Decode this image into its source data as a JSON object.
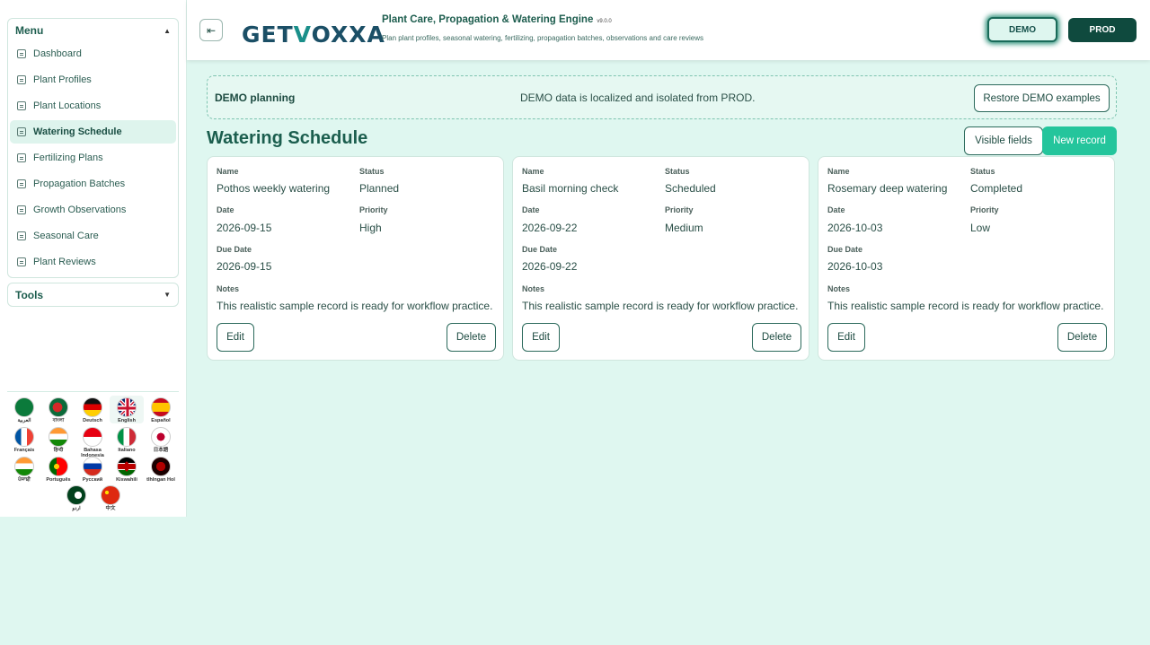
{
  "sidebar": {
    "menu_title": "Menu",
    "items": [
      {
        "label": "Dashboard"
      },
      {
        "label": "Plant Profiles"
      },
      {
        "label": "Plant Locations"
      },
      {
        "label": "Watering Schedule"
      },
      {
        "label": "Fertilizing Plans"
      },
      {
        "label": "Propagation Batches"
      },
      {
        "label": "Growth Observations"
      },
      {
        "label": "Seasonal Care"
      },
      {
        "label": "Plant Reviews"
      }
    ],
    "tools_title": "Tools",
    "languages": [
      {
        "label": "العربية"
      },
      {
        "label": "বাংলা"
      },
      {
        "label": "Deutsch"
      },
      {
        "label": "English"
      },
      {
        "label": "Español"
      },
      {
        "label": "Français"
      },
      {
        "label": "हिन्दी"
      },
      {
        "label": "Bahasa Indonesia"
      },
      {
        "label": "Italiano"
      },
      {
        "label": "日本語"
      },
      {
        "label": "ਪੰਜਾਬੀ"
      },
      {
        "label": "Português"
      },
      {
        "label": "Русский"
      },
      {
        "label": "Kiswahili"
      },
      {
        "label": "tlhIngan Hol"
      },
      {
        "label": "اردو"
      },
      {
        "label": "中文"
      }
    ]
  },
  "header": {
    "logo_a": "GET",
    "logo_b": "V",
    "logo_c": "OXXA",
    "title": "Plant Care, Propagation & Watering Engine",
    "version": "v9.0.0",
    "subtitle": "Plan plant profiles, seasonal watering, fertilizing, propagation batches, observations and care reviews",
    "demo_label": "DEMO",
    "prod_label": "PROD"
  },
  "banner": {
    "title": "DEMO planning",
    "message": "DEMO data is localized and isolated from PROD.",
    "restore_label": "Restore DEMO examples"
  },
  "main": {
    "title": "Watering Schedule",
    "visible_fields_label": "Visible fields",
    "new_record_label": "New record",
    "field_labels": {
      "name": "Name",
      "status": "Status",
      "date": "Date",
      "priority": "Priority",
      "due_date": "Due Date",
      "notes": "Notes"
    },
    "edit_label": "Edit",
    "delete_label": "Delete",
    "records": [
      {
        "name": "Pothos weekly watering",
        "status": "Planned",
        "date": "2026-09-15",
        "priority": "High",
        "due_date": "2026-09-15",
        "notes": "This realistic sample record is ready for workflow practice."
      },
      {
        "name": "Basil morning check",
        "status": "Scheduled",
        "date": "2026-09-22",
        "priority": "Medium",
        "due_date": "2026-09-22",
        "notes": "This realistic sample record is ready for workflow practice."
      },
      {
        "name": "Rosemary deep watering",
        "status": "Completed",
        "date": "2026-10-03",
        "priority": "Low",
        "due_date": "2026-10-03",
        "notes": "This realistic sample record is ready for workflow practice."
      }
    ]
  }
}
